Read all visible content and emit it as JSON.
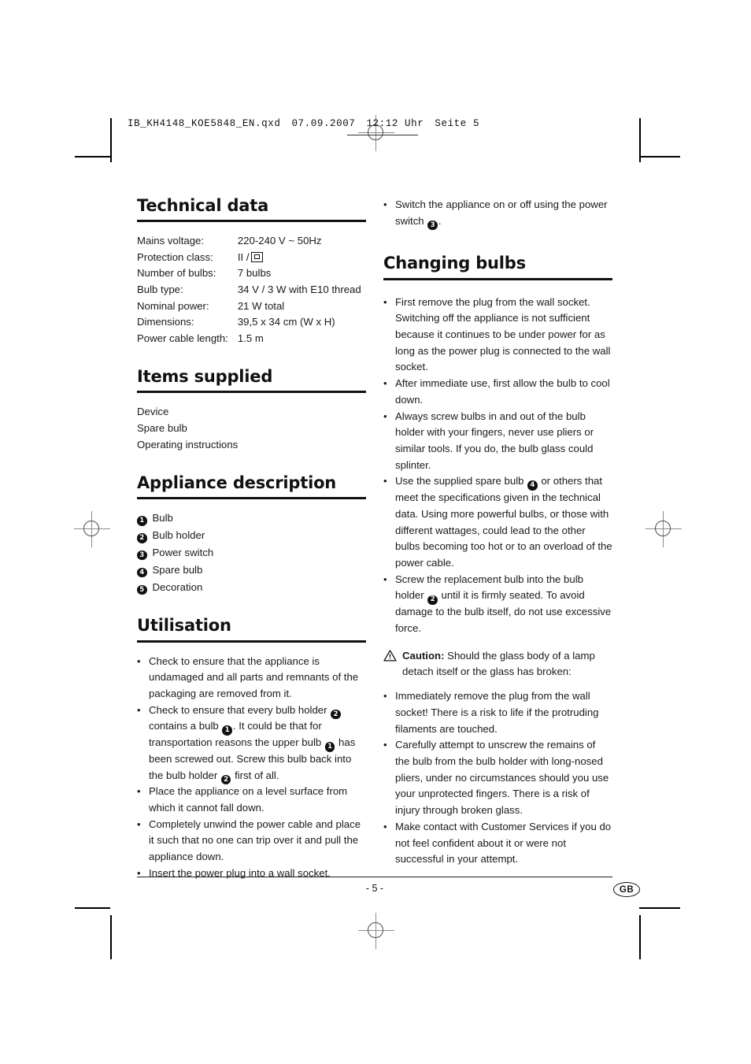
{
  "file_header": {
    "filename": "IB_KH4148_KOE5848_EN.qxd",
    "date": "07.09.2007",
    "time": "12:12 Uhr",
    "page_label": "Seite 5"
  },
  "left_column": {
    "technical_data": {
      "title": "Technical data",
      "rows": [
        {
          "key": "Mains voltage:",
          "value": "220-240 V ~ 50Hz"
        },
        {
          "key": "Protection class:",
          "value": "II /",
          "symbol": "class-2-double-insulation"
        },
        {
          "key": "Number of bulbs:",
          "value": "7 bulbs"
        },
        {
          "key": "Bulb type:",
          "value": "34 V / 3 W with E10 thread"
        },
        {
          "key": "Nominal power:",
          "value": "21 W total"
        },
        {
          "key": "Dimensions:",
          "value": "39,5 x 34 cm (W x H)"
        },
        {
          "key": "Power cable length:",
          "value": "1.5 m"
        }
      ]
    },
    "items_supplied": {
      "title": "Items supplied",
      "items": [
        "Device",
        "Spare bulb",
        "Operating instructions"
      ]
    },
    "appliance_description": {
      "title": "Appliance description",
      "items": [
        {
          "num": "1",
          "label": "Bulb"
        },
        {
          "num": "2",
          "label": "Bulb holder"
        },
        {
          "num": "3",
          "label": "Power switch"
        },
        {
          "num": "4",
          "label": "Spare bulb"
        },
        {
          "num": "5",
          "label": "Decoration"
        }
      ]
    },
    "utilisation": {
      "title": "Utilisation",
      "bullets": [
        {
          "pre": "Check to ensure that the appliance is undamaged and all parts and remnants of the packaging are removed from it."
        },
        {
          "pre": "Check to ensure that every bulb holder ",
          "b1": "2",
          "mid1": " contains a bulb ",
          "b2": "1",
          "mid2": ". It could be that for transportation reasons the upper bulb ",
          "b3": "1",
          "mid3": " has been screwed out. Screw this bulb back into the bulb holder ",
          "b4": "2",
          "post": " first of all."
        },
        {
          "pre": "Place the appliance on a level surface from which it cannot fall down."
        },
        {
          "pre": "Completely unwind the power cable and place it such that no one can trip over it and pull the appliance down."
        },
        {
          "pre": "Insert the power plug into a wall socket."
        }
      ]
    }
  },
  "right_column": {
    "continued_bullet": {
      "pre": "Switch the appliance on or off using the power switch ",
      "badge": "3",
      "post": "."
    },
    "changing_bulbs": {
      "title": "Changing bulbs",
      "bullets": [
        {
          "pre": "First remove the plug from the wall socket. Switching off the appliance is not sufficient because it continues to be under power for as long as the power plug is connected to the wall socket."
        },
        {
          "pre": "After immediate use, first allow the bulb to cool down."
        },
        {
          "pre": "Always screw bulbs in and out of the bulb holder with your fingers, never use pliers or similar tools. If you do, the bulb glass could splinter."
        },
        {
          "pre": "Use the supplied spare bulb ",
          "b1": "4",
          "post": " or others that meet the specifications given in the technical data. Using more powerful bulbs, or those with different wattages, could lead to the other bulbs becoming too hot or to an overload of the power cable."
        },
        {
          "pre": "Screw the replacement bulb into the bulb holder ",
          "b1": "2",
          "post": " until it is firmly seated. To avoid damage to the bulb itself, do not use excessive force."
        }
      ],
      "caution": {
        "label": "Caution:",
        "text": "Should the glass body of a lamp detach itself or the glass has broken:",
        "bullets": [
          "Immediately remove the plug from the wall socket! There is a risk to life if the protruding filaments are touched.",
          "Carefully attempt to unscrew the remains of the bulb from the bulb holder with long-nosed pliers, under no circumstances should you use your unprotected fingers. There is a risk of injury through broken glass.",
          "Make contact with Customer Services if you do not feel confident about it or were not successful in your attempt."
        ]
      }
    }
  },
  "footer": {
    "page_number": "- 5 -",
    "language_badge": "GB"
  },
  "bullet_glyph": "•",
  "colors": {
    "text": "#1a1a1a",
    "rule": "#111111",
    "badge_bg": "#111111",
    "badge_fg": "#ffffff"
  }
}
